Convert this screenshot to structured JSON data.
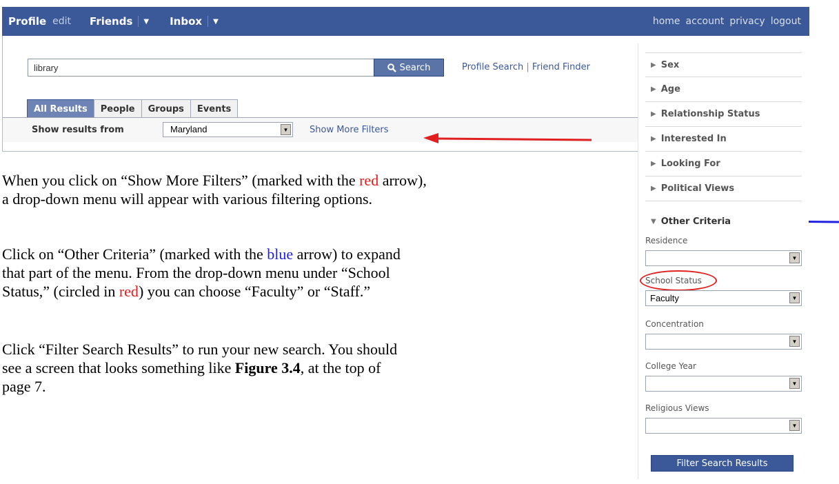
{
  "navbar": {
    "profile": "Profile",
    "edit": "edit",
    "friends": "Friends",
    "inbox": "Inbox",
    "arrow": "▼",
    "home": "home",
    "account": "account",
    "privacy": "privacy",
    "logout": "logout"
  },
  "search": {
    "query": "library",
    "button_label": "Search",
    "profile_search": "Profile Search",
    "link_sep": "|",
    "friend_finder": "Friend Finder"
  },
  "tabs": [
    {
      "label": "All Results"
    },
    {
      "label": "People"
    },
    {
      "label": "Groups"
    },
    {
      "label": "Events"
    }
  ],
  "filter_bar": {
    "label": "Show results from",
    "selected": "Maryland",
    "more_filters": "Show More Filters"
  },
  "prose": {
    "p1_a": "When you click on “Show More Filters” (marked with the ",
    "p1_red": "red",
    "p1_b": " arrow),",
    "p1_line2": "a drop-down menu will appear with various filtering options.",
    "p2_a": "Click on “Other Criteria” (marked with the ",
    "p2_blue": "blue",
    "p2_b": " arrow) to expand",
    "p2_line2": "that part of the menu.  From the drop-down menu under “School",
    "p2_line3a": "Status,” (circled in ",
    "p2_red": "red",
    "p2_line3b": ") you can choose “Faculty” or “Staff.”",
    "p3_line1": "Click “Filter Search Results” to run your new search. You should",
    "p3_line2a": "see a screen that looks something like ",
    "p3_fig": "Figure 3.4",
    "p3_line2b": ", at the top of",
    "p3_line3": "page 7."
  },
  "side_panel": {
    "categories": [
      {
        "label": "Sex",
        "arrow": "▶"
      },
      {
        "label": "Age",
        "arrow": "▶"
      },
      {
        "label": "Relationship Status",
        "arrow": "▶"
      },
      {
        "label": "Interested In",
        "arrow": "▶"
      },
      {
        "label": "Looking For",
        "arrow": "▶"
      },
      {
        "label": "Political Views",
        "arrow": "▶"
      }
    ],
    "open_category": {
      "label": "Other Criteria",
      "arrow": "▼"
    },
    "fields": [
      {
        "label": "Residence",
        "value": ""
      },
      {
        "label": "School Status",
        "value": "Faculty"
      },
      {
        "label": "Concentration",
        "value": ""
      },
      {
        "label": "College Year",
        "value": ""
      },
      {
        "label": "Religious Views",
        "value": ""
      }
    ],
    "dropdown_glyph": "▼",
    "filter_button": "Filter Search Results"
  },
  "colors": {
    "facebook_blue": "#3b5998",
    "annotation_red": "#e02020",
    "annotation_blue": "#2020e0"
  }
}
